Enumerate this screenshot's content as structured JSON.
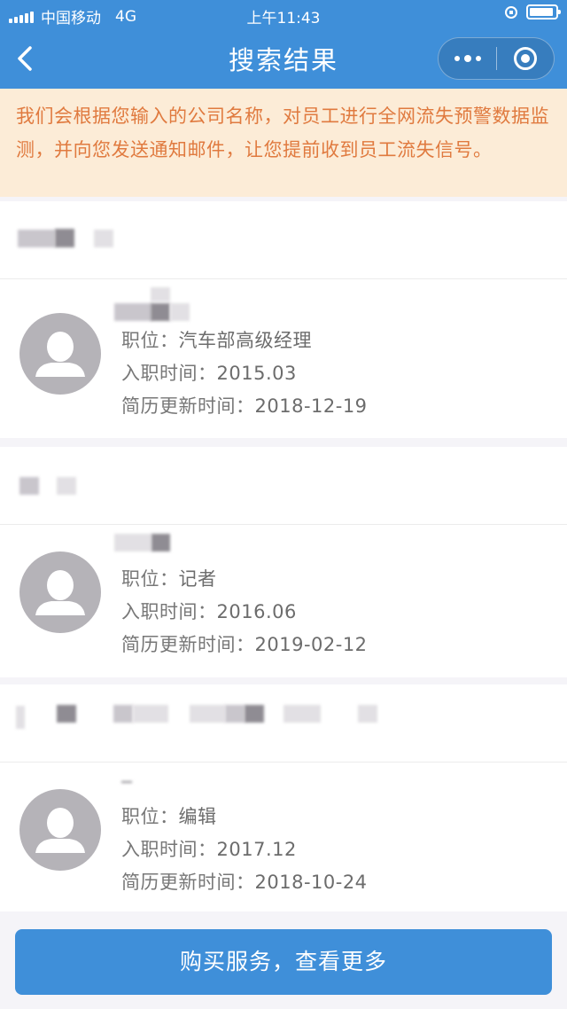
{
  "status_bar": {
    "carrier": "中国移动",
    "network": "4G",
    "time": "上午11:43"
  },
  "nav": {
    "title": "搜索结果"
  },
  "notice": {
    "text": "我们会根据您输入的公司名称，对员工进行全网流失预警数据监测，并向您发送通知邮件，让您提前收到员工流失信号。"
  },
  "results": [
    {
      "position_label": "职位：",
      "position": "汽车部高级经理",
      "join_label": "入职时间：",
      "join_date": "2015.03",
      "update_label": "简历更新时间：",
      "update_date": "2018-12-19"
    },
    {
      "position_label": "职位：",
      "position": "记者",
      "join_label": "入职时间：",
      "join_date": "2016.06",
      "update_label": "简历更新时间：",
      "update_date": "2019-02-12"
    },
    {
      "position_label": "职位：",
      "position": "编辑",
      "join_label": "入职时间：",
      "join_date": "2017.12",
      "update_label": "简历更新时间：",
      "update_date": "2018-10-24"
    }
  ],
  "footer": {
    "buy_label": "购买服务，查看更多"
  },
  "colors": {
    "primary": "#3f8fd9",
    "notice_bg": "#fcecd7",
    "notice_text": "#e07a3f"
  }
}
